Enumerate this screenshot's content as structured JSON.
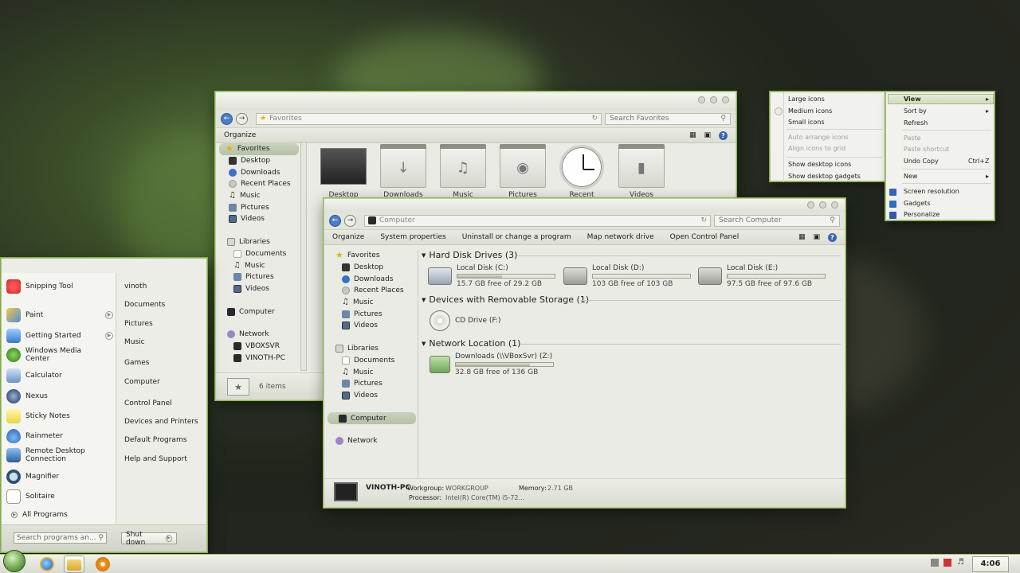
{
  "favorites_window": {
    "address": "Favorites",
    "search_placeholder": "Search Favorites",
    "toolbar": {
      "organize": "Organize"
    },
    "nav": {
      "favorites": "Favorites",
      "items": [
        "Desktop",
        "Downloads",
        "Recent Places",
        "Music",
        "Pictures",
        "Videos"
      ],
      "libraries": "Libraries",
      "lib_items": [
        "Documents",
        "Music",
        "Pictures",
        "Videos"
      ],
      "computer": "Computer",
      "network": "Network",
      "net_items": [
        "VBOXSVR",
        "VINOTH-PC"
      ]
    },
    "tiles": [
      "Desktop",
      "Downloads",
      "Music",
      "Pictures",
      "Recent",
      "Videos"
    ],
    "status": "6 items"
  },
  "computer_window": {
    "address": "Computer",
    "search_placeholder": "Search Computer",
    "toolbar": [
      "Organize",
      "System properties",
      "Uninstall or change a program",
      "Map network drive",
      "Open Control Panel"
    ],
    "nav": {
      "favorites": "Favorites",
      "items": [
        "Desktop",
        "Downloads",
        "Recent Places",
        "Music",
        "Pictures",
        "Videos"
      ],
      "libraries": "Libraries",
      "lib_items": [
        "Documents",
        "Music",
        "Pictures",
        "Videos"
      ],
      "computer": "Computer",
      "network": "Network"
    },
    "sections": {
      "hdd": "Hard Disk Drives (3)",
      "removable": "Devices with Removable Storage (1)",
      "network": "Network Location (1)"
    },
    "drives": [
      {
        "name": "Local Disk (C:)",
        "free": "15.7 GB free of 29.2 GB",
        "used_fraction": 0.46
      },
      {
        "name": "Local Disk (D:)",
        "free": "103 GB free of 103 GB",
        "used_fraction": 0.0
      },
      {
        "name": "Local Disk (E:)",
        "free": "97.5 GB free of 97.6 GB",
        "used_fraction": 0.01
      }
    ],
    "cd": {
      "name": "CD Drive (F:)"
    },
    "netdrive": {
      "name": "Downloads (\\\\VBoxSvr) (Z:)",
      "free": "32.8 GB free of 136 GB",
      "used_fraction": 0.76
    },
    "details": {
      "pc_name": "VINOTH-PC",
      "workgroup_label": "Workgroup:",
      "workgroup": "WORKGROUP",
      "memory_label": "Memory:",
      "memory": "2.71 GB",
      "processor_label": "Processor:",
      "processor": "Intel(R) Core(TM) i5-72..."
    }
  },
  "start_menu": {
    "programs": [
      "Snipping Tool",
      "Paint",
      "Getting Started",
      "Windows Media Center",
      "Calculator",
      "Nexus",
      "Sticky Notes",
      "Rainmeter",
      "Remote Desktop Connection",
      "Magnifier",
      "Solitaire"
    ],
    "all_programs": "All Programs",
    "right": [
      "vinoth",
      "Documents",
      "Pictures",
      "Music",
      "Games",
      "Computer",
      "Control Panel",
      "Devices and Printers",
      "Default Programs",
      "Help and Support"
    ],
    "search_placeholder": "Search programs an...",
    "shutdown": "Shut down"
  },
  "view_submenu": {
    "items": [
      "Large icons",
      "Medium icons",
      "Small icons"
    ],
    "disabled": [
      "Auto arrange icons",
      "Align icons to grid"
    ],
    "toggles": [
      "Show desktop icons",
      "Show desktop gadgets"
    ]
  },
  "context_menu": {
    "view": "View",
    "sort_by": "Sort by",
    "refresh": "Refresh",
    "paste": "Paste",
    "paste_shortcut": "Paste shortcut",
    "undo_copy": "Undo Copy",
    "undo_shortcut": "Ctrl+Z",
    "new": "New",
    "screen_resolution": "Screen resolution",
    "gadgets": "Gadgets",
    "personalize": "Personalize"
  },
  "taskbar": {
    "time": "4:06 PM"
  }
}
